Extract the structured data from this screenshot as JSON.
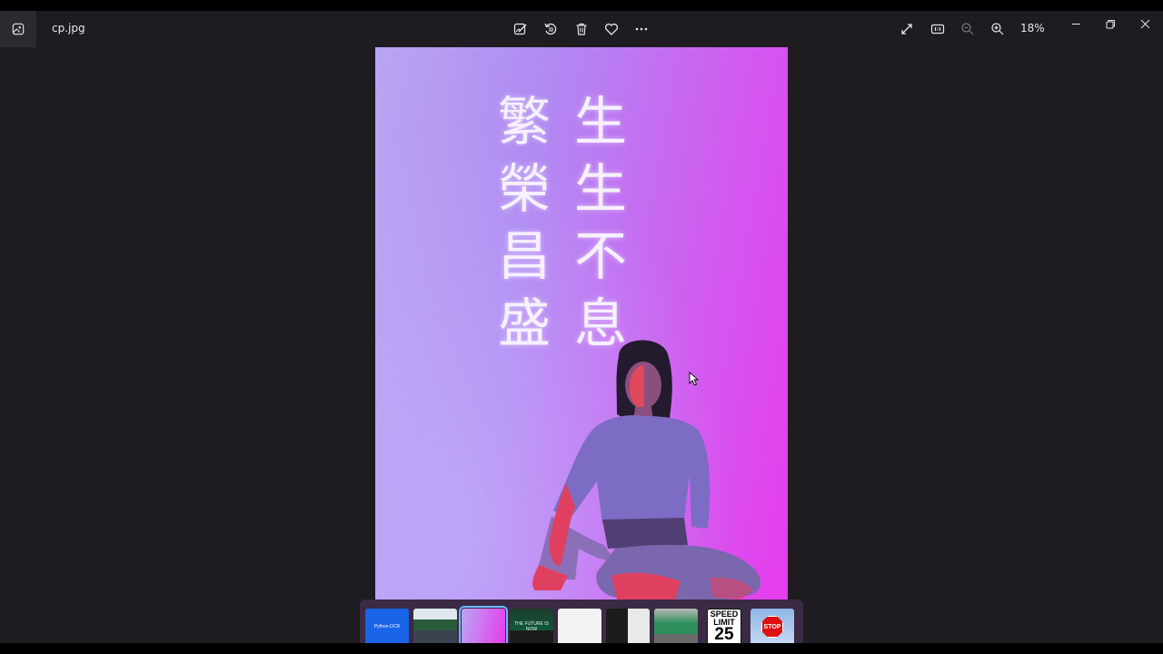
{
  "titlebar": {
    "filename": "cp.jpg",
    "zoom_level": "18%"
  },
  "toolbar": {
    "icons": [
      "edit-image-icon",
      "rotate-icon",
      "delete-icon",
      "favorite-icon",
      "more-icon"
    ],
    "right_icons": [
      "fullscreen-icon",
      "actual-size-icon",
      "zoom-out-icon",
      "zoom-in-icon"
    ]
  },
  "window_controls": [
    "minimize-icon",
    "restore-icon",
    "close-icon"
  ],
  "photo": {
    "poem_right_column": [
      "生",
      "生",
      "不",
      "息"
    ],
    "poem_left_column": [
      "繁",
      "榮",
      "昌",
      "盛"
    ]
  },
  "filmstrip": {
    "selected_index": 2,
    "thumbnails": [
      {
        "label": "Python-OCR"
      },
      {
        "label": ""
      },
      {
        "label": ""
      },
      {
        "label": "THE FUTURE IS NOW"
      },
      {
        "label": ""
      },
      {
        "label": ""
      },
      {
        "label": ""
      },
      {
        "line1": "SPEED",
        "line2": "LIMIT",
        "line3": "25"
      },
      {
        "label": "STOP"
      }
    ]
  },
  "colors": {
    "window_bg": "#1e1c21",
    "filmstrip_bg": "#3a2a44",
    "selection_outline": "#6fb7ff"
  }
}
